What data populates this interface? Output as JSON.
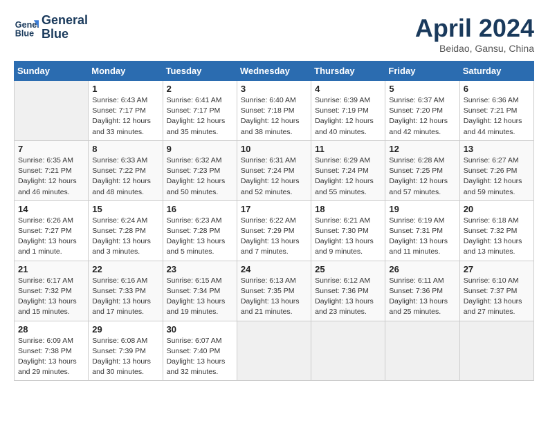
{
  "header": {
    "logo_line1": "General",
    "logo_line2": "Blue",
    "month_title": "April 2024",
    "subtitle": "Beidao, Gansu, China"
  },
  "weekdays": [
    "Sunday",
    "Monday",
    "Tuesday",
    "Wednesday",
    "Thursday",
    "Friday",
    "Saturday"
  ],
  "weeks": [
    [
      {
        "day": "",
        "info": ""
      },
      {
        "day": "1",
        "info": "Sunrise: 6:43 AM\nSunset: 7:17 PM\nDaylight: 12 hours\nand 33 minutes."
      },
      {
        "day": "2",
        "info": "Sunrise: 6:41 AM\nSunset: 7:17 PM\nDaylight: 12 hours\nand 35 minutes."
      },
      {
        "day": "3",
        "info": "Sunrise: 6:40 AM\nSunset: 7:18 PM\nDaylight: 12 hours\nand 38 minutes."
      },
      {
        "day": "4",
        "info": "Sunrise: 6:39 AM\nSunset: 7:19 PM\nDaylight: 12 hours\nand 40 minutes."
      },
      {
        "day": "5",
        "info": "Sunrise: 6:37 AM\nSunset: 7:20 PM\nDaylight: 12 hours\nand 42 minutes."
      },
      {
        "day": "6",
        "info": "Sunrise: 6:36 AM\nSunset: 7:21 PM\nDaylight: 12 hours\nand 44 minutes."
      }
    ],
    [
      {
        "day": "7",
        "info": "Sunrise: 6:35 AM\nSunset: 7:21 PM\nDaylight: 12 hours\nand 46 minutes."
      },
      {
        "day": "8",
        "info": "Sunrise: 6:33 AM\nSunset: 7:22 PM\nDaylight: 12 hours\nand 48 minutes."
      },
      {
        "day": "9",
        "info": "Sunrise: 6:32 AM\nSunset: 7:23 PM\nDaylight: 12 hours\nand 50 minutes."
      },
      {
        "day": "10",
        "info": "Sunrise: 6:31 AM\nSunset: 7:24 PM\nDaylight: 12 hours\nand 52 minutes."
      },
      {
        "day": "11",
        "info": "Sunrise: 6:29 AM\nSunset: 7:24 PM\nDaylight: 12 hours\nand 55 minutes."
      },
      {
        "day": "12",
        "info": "Sunrise: 6:28 AM\nSunset: 7:25 PM\nDaylight: 12 hours\nand 57 minutes."
      },
      {
        "day": "13",
        "info": "Sunrise: 6:27 AM\nSunset: 7:26 PM\nDaylight: 12 hours\nand 59 minutes."
      }
    ],
    [
      {
        "day": "14",
        "info": "Sunrise: 6:26 AM\nSunset: 7:27 PM\nDaylight: 13 hours\nand 1 minute."
      },
      {
        "day": "15",
        "info": "Sunrise: 6:24 AM\nSunset: 7:28 PM\nDaylight: 13 hours\nand 3 minutes."
      },
      {
        "day": "16",
        "info": "Sunrise: 6:23 AM\nSunset: 7:28 PM\nDaylight: 13 hours\nand 5 minutes."
      },
      {
        "day": "17",
        "info": "Sunrise: 6:22 AM\nSunset: 7:29 PM\nDaylight: 13 hours\nand 7 minutes."
      },
      {
        "day": "18",
        "info": "Sunrise: 6:21 AM\nSunset: 7:30 PM\nDaylight: 13 hours\nand 9 minutes."
      },
      {
        "day": "19",
        "info": "Sunrise: 6:19 AM\nSunset: 7:31 PM\nDaylight: 13 hours\nand 11 minutes."
      },
      {
        "day": "20",
        "info": "Sunrise: 6:18 AM\nSunset: 7:32 PM\nDaylight: 13 hours\nand 13 minutes."
      }
    ],
    [
      {
        "day": "21",
        "info": "Sunrise: 6:17 AM\nSunset: 7:32 PM\nDaylight: 13 hours\nand 15 minutes."
      },
      {
        "day": "22",
        "info": "Sunrise: 6:16 AM\nSunset: 7:33 PM\nDaylight: 13 hours\nand 17 minutes."
      },
      {
        "day": "23",
        "info": "Sunrise: 6:15 AM\nSunset: 7:34 PM\nDaylight: 13 hours\nand 19 minutes."
      },
      {
        "day": "24",
        "info": "Sunrise: 6:13 AM\nSunset: 7:35 PM\nDaylight: 13 hours\nand 21 minutes."
      },
      {
        "day": "25",
        "info": "Sunrise: 6:12 AM\nSunset: 7:36 PM\nDaylight: 13 hours\nand 23 minutes."
      },
      {
        "day": "26",
        "info": "Sunrise: 6:11 AM\nSunset: 7:36 PM\nDaylight: 13 hours\nand 25 minutes."
      },
      {
        "day": "27",
        "info": "Sunrise: 6:10 AM\nSunset: 7:37 PM\nDaylight: 13 hours\nand 27 minutes."
      }
    ],
    [
      {
        "day": "28",
        "info": "Sunrise: 6:09 AM\nSunset: 7:38 PM\nDaylight: 13 hours\nand 29 minutes."
      },
      {
        "day": "29",
        "info": "Sunrise: 6:08 AM\nSunset: 7:39 PM\nDaylight: 13 hours\nand 30 minutes."
      },
      {
        "day": "30",
        "info": "Sunrise: 6:07 AM\nSunset: 7:40 PM\nDaylight: 13 hours\nand 32 minutes."
      },
      {
        "day": "",
        "info": ""
      },
      {
        "day": "",
        "info": ""
      },
      {
        "day": "",
        "info": ""
      },
      {
        "day": "",
        "info": ""
      }
    ]
  ]
}
